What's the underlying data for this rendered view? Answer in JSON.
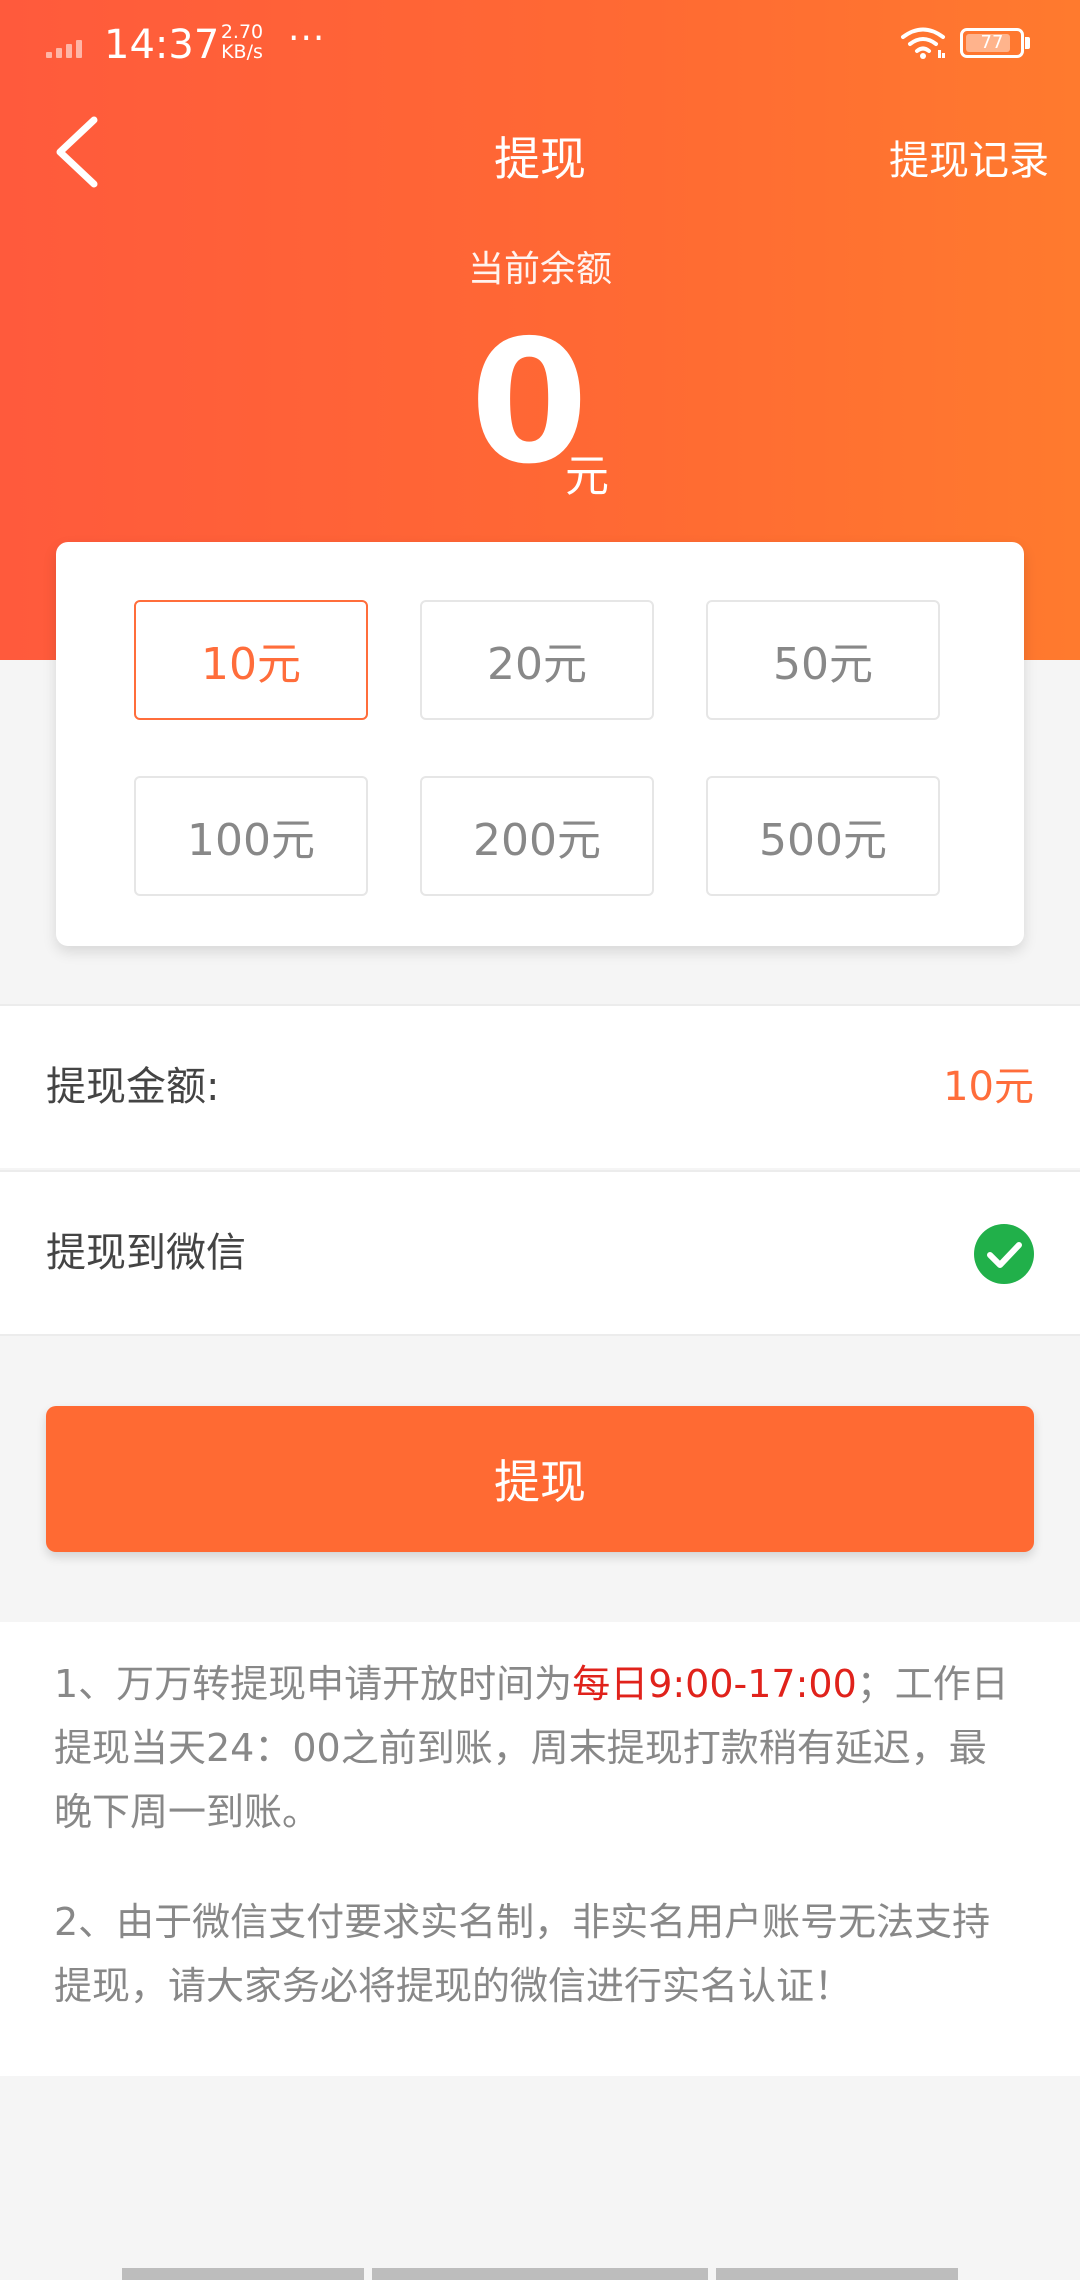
{
  "status_bar": {
    "time": "14:37",
    "speed_value": "2.70",
    "speed_unit": "KB/s",
    "more": "···",
    "battery": "77",
    "icons": [
      "signal-icon",
      "wifi-icon",
      "battery-icon"
    ]
  },
  "nav": {
    "back_icon": "chevron-left-icon",
    "title": "提现",
    "right_link": "提现记录"
  },
  "balance": {
    "label": "当前余额",
    "value": "0",
    "unit": "元"
  },
  "amount_options": [
    {
      "label": "10元",
      "selected": true
    },
    {
      "label": "20元",
      "selected": false
    },
    {
      "label": "50元",
      "selected": false
    },
    {
      "label": "100元",
      "selected": false
    },
    {
      "label": "200元",
      "selected": false
    },
    {
      "label": "500元",
      "selected": false
    }
  ],
  "withdraw_amount": {
    "label": "提现金额:",
    "value": "10元"
  },
  "withdraw_to": {
    "label": "提现到微信",
    "icon": "check-circle-icon"
  },
  "submit_label": "提现",
  "notes": {
    "n1_a": "1、万万转提现申请开放时间为",
    "n1_highlight": "每日9:00-17:00",
    "n1_b": "；工作日提现当天24：00之前到账，周末提现打款稍有延迟，最晚下周一到账。",
    "n2": "2、由于微信支付要求实名制，非实名用户账号无法支持提现，请大家务必将提现的微信进行实名认证！"
  },
  "colors": {
    "header_start": "#ff5a3c",
    "header_end": "#ff7a2e",
    "accent": "#ff6d3b",
    "highlight_red": "#e0221b",
    "check_green": "#21b04a"
  }
}
